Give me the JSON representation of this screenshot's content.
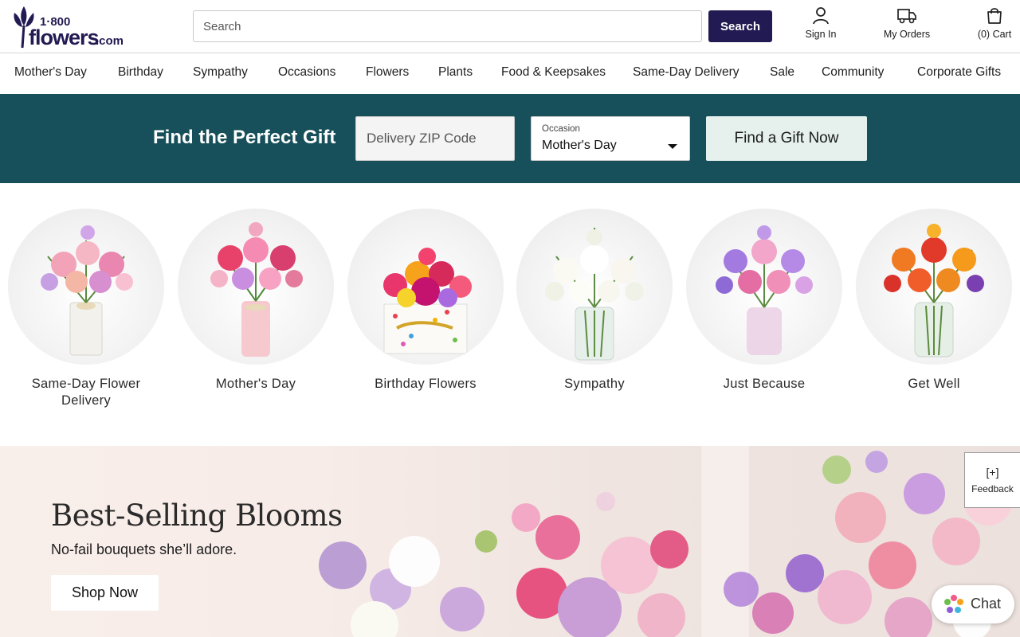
{
  "header": {
    "logo_text_top": "1·800",
    "logo_text_main": "flowers",
    "logo_text_tld": ".com",
    "search_placeholder": "Search",
    "search_button": "Search",
    "sign_in": "Sign In",
    "my_orders": "My Orders",
    "cart": "(0) Cart",
    "icons": {
      "sign_in": "user-icon",
      "orders": "truck-icon",
      "cart": "shopping-bag-icon"
    }
  },
  "nav": {
    "items": [
      "Mother's Day",
      "Birthday",
      "Sympathy",
      "Occasions",
      "Flowers",
      "Plants",
      "Food & Keepsakes",
      "Same-Day Delivery",
      "Sale",
      "Community",
      "Corporate Gifts"
    ]
  },
  "gift_finder": {
    "title": "Find the Perfect Gift",
    "zip_placeholder": "Delivery ZIP Code",
    "occasion_label": "Occasion",
    "occasion_value": "Mother's Day",
    "button": "Find a Gift Now",
    "background_color": "#17505a"
  },
  "categories": [
    {
      "label": "Same-Day Flower Delivery"
    },
    {
      "label": "Mother's Day"
    },
    {
      "label": "Birthday Flowers"
    },
    {
      "label": "Sympathy"
    },
    {
      "label": "Just Because"
    },
    {
      "label": "Get Well"
    }
  ],
  "hero": {
    "title": "Best-Selling Blooms",
    "subtitle": "No-fail bouquets she’ll adore.",
    "button": "Shop Now"
  },
  "feedback": {
    "plus": "[+]",
    "label": "Feedback"
  },
  "chat": {
    "label": "Chat"
  },
  "colors": {
    "brand_navy": "#221a52",
    "teal": "#17505a",
    "light_mint": "#e6f1ee"
  }
}
